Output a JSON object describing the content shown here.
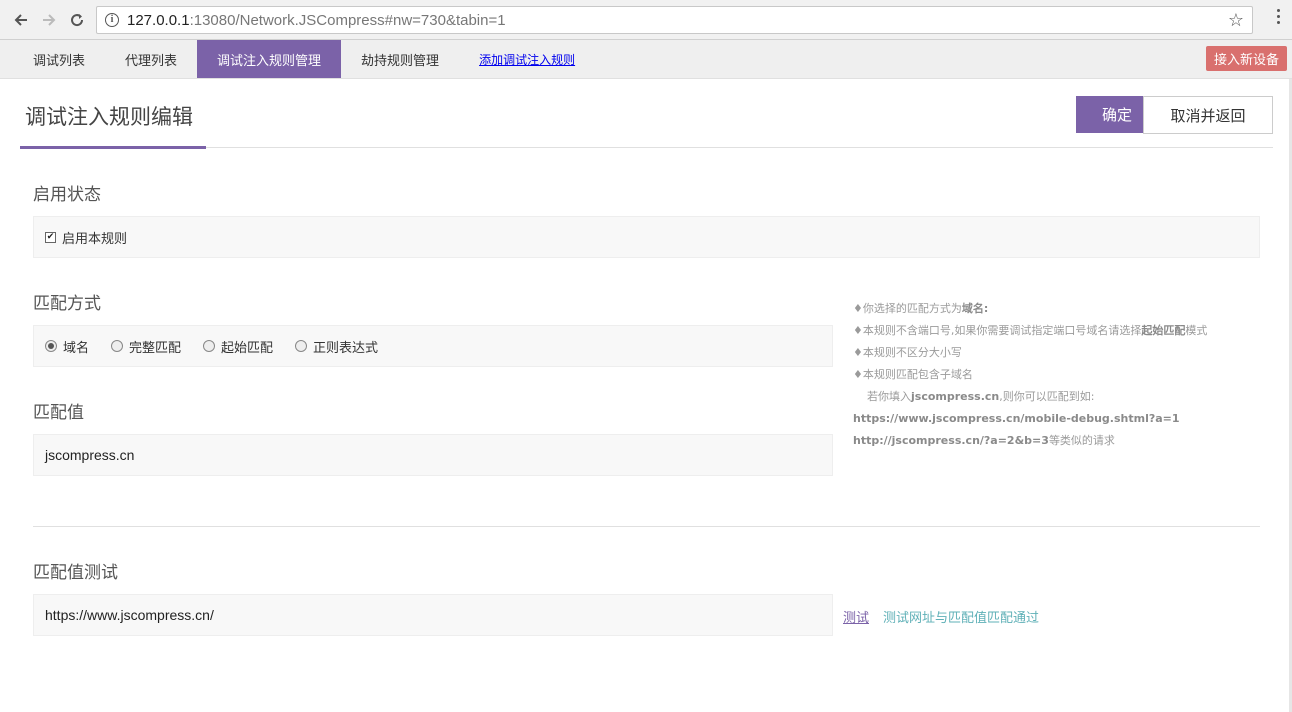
{
  "browser": {
    "url_host": "127.0.0.1",
    "url_rest": ":13080/Network.JSCompress#nw=730&tabin=1"
  },
  "nav": {
    "tabs": [
      {
        "label": "调试列表"
      },
      {
        "label": "代理列表"
      },
      {
        "label": "调试注入规则管理"
      },
      {
        "label": "劫持规则管理"
      }
    ],
    "add_link": "添加调试注入规则",
    "new_device": "接入新设备"
  },
  "header": {
    "title": "调试注入规则编辑",
    "confirm": "确定",
    "cancel": "取消并返回"
  },
  "enable": {
    "section_label": "启用状态",
    "checkbox_label": "启用本规则",
    "checked": true
  },
  "match_mode": {
    "section_label": "匹配方式",
    "options": [
      "域名",
      "完整匹配",
      "起始匹配",
      "正则表达式"
    ],
    "selected": "域名"
  },
  "match_value": {
    "section_label": "匹配值",
    "value": "jscompress.cn"
  },
  "hint": {
    "line1_prefix": "♦你选择的匹配方式为",
    "line1_bold": "域名:",
    "line2_prefix": "♦本规则不含端口号,如果你需要调试指定端口号域名请选择",
    "line2_bold": "起始匹配",
    "line2_suffix": "模式",
    "line3": "♦本规则不区分大小写",
    "line4": "♦本规则匹配包含子域名",
    "line5_prefix": "若你填入",
    "line5_bold": "jscompress.cn",
    "line5_suffix": ",则你可以匹配到如:",
    "line6_bold": "https://www.jscompress.cn/mobile-debug.shtml?a=1",
    "line7_bold": "http://jscompress.cn/?a=2&b=3",
    "line7_suffix": "等类似的请求"
  },
  "test": {
    "section_label": "匹配值测试",
    "value": "https://www.jscompress.cn/",
    "link": "测试",
    "result": "测试网址与匹配值匹配通过"
  },
  "colors": {
    "accent": "#7b62a8",
    "danger": "#d9706e",
    "success_text": "#5fb0b7"
  }
}
